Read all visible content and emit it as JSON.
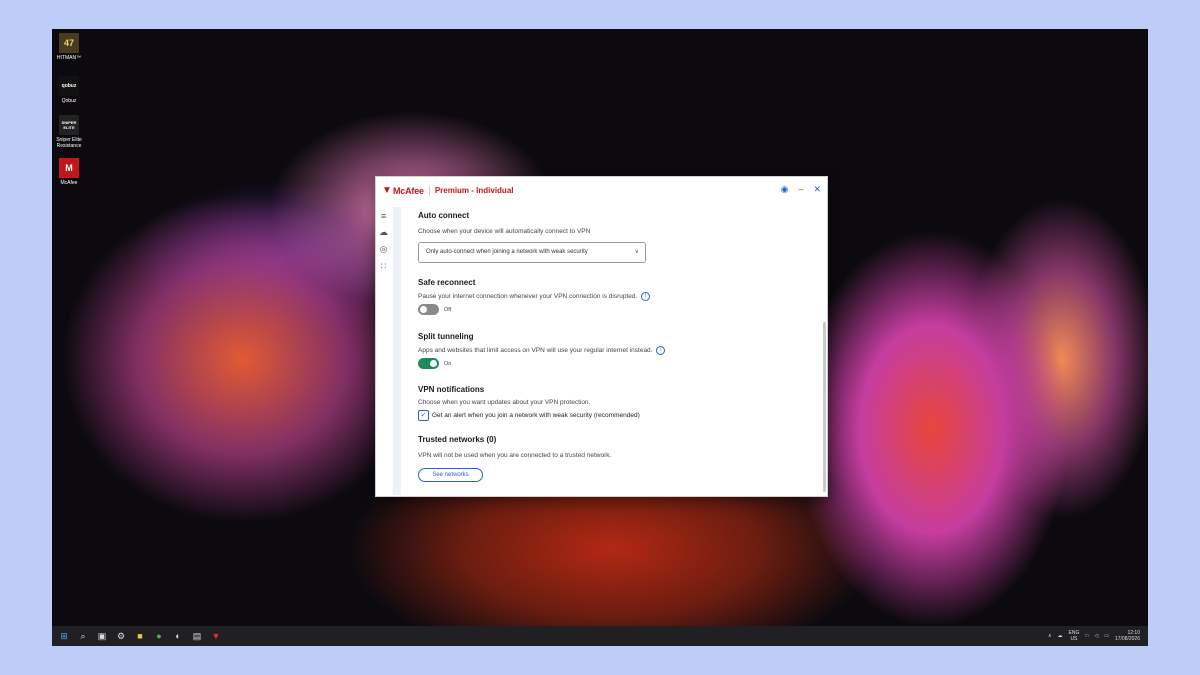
{
  "desktop": {
    "icons": [
      {
        "glyph": "47",
        "label": "HITMAN™"
      },
      {
        "glyph": "qobuz",
        "label": "Qobuz"
      },
      {
        "glyph": "SNIPER ELITE",
        "label": "Sniper Elite Resistance"
      },
      {
        "glyph": "M",
        "label": "McAfee"
      }
    ]
  },
  "app": {
    "brand": "McAfee",
    "product": "Premium - Individual",
    "sections": {
      "auto_connect": {
        "title": "Auto connect",
        "description": "Choose when your device will automatically connect to VPN",
        "dropdown_value": "Only auto-connect when joining a network with weak security"
      },
      "safe_reconnect": {
        "title": "Safe reconnect",
        "description": "Pause your internet connection whenever your VPN connection is disrupted.",
        "toggle_label": "Off",
        "toggle_state": "off"
      },
      "split_tunneling": {
        "title": "Split tunneling",
        "description": "Apps and websites that limit access on VPN will use your regular internet instead.",
        "toggle_label": "On",
        "toggle_state": "on"
      },
      "vpn_notifications": {
        "title": "VPN notifications",
        "description": "Choose when you want updates about your VPN protection.",
        "checkbox_label": "Get an alert when you join a network with weak security (recommended)",
        "checked": true
      },
      "trusted_networks": {
        "title": "Trusted networks (0)",
        "description": "VPN will not be used when you are connected to a trusted network.",
        "button_label": "See networks"
      }
    }
  },
  "taskbar": {
    "language": "ENG",
    "region": "US",
    "time": "12:10",
    "date": "17/08/2026"
  },
  "colors": {
    "brand_red": "#c01818",
    "accent_blue": "#2b5fd9",
    "toggle_on": "#1e8a59"
  }
}
